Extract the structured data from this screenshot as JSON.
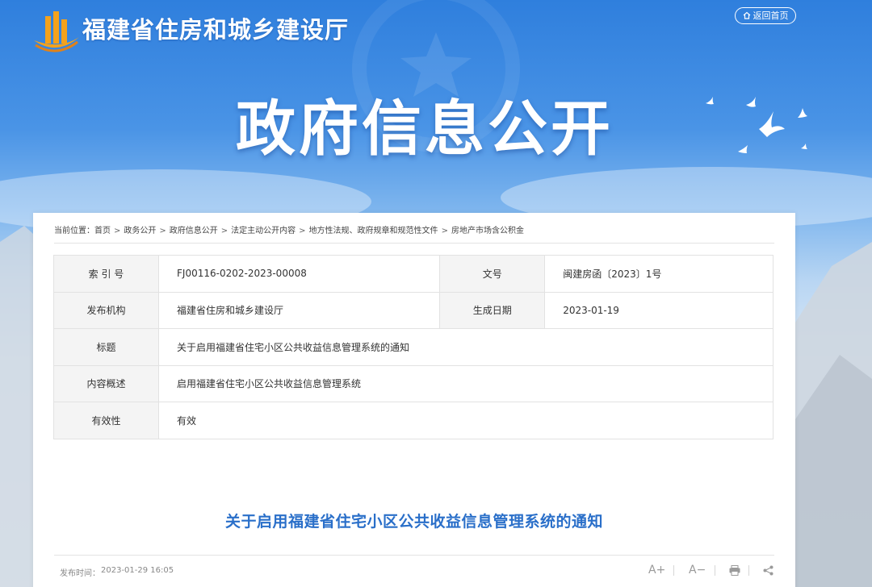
{
  "header": {
    "site_title": "福建省住房和城乡建设厅",
    "home_label": "返回首页",
    "banner_title": "政府信息公开"
  },
  "breadcrumb": {
    "prefix": "当前位置：",
    "items": [
      "首页",
      "政务公开",
      "政府信息公开",
      "法定主动公开内容",
      "地方性法规、政府规章和规范性文件",
      "房地产市场含公积金"
    ],
    "separator": ">"
  },
  "meta_table": {
    "index_label": "索 引 号",
    "index_value": "FJ00116-0202-2023-00008",
    "docno_label": "文号",
    "docno_value": "闽建房函〔2023〕1号",
    "issuer_label": "发布机构",
    "issuer_value": "福建省住房和城乡建设厅",
    "date_label": "生成日期",
    "date_value": "2023-01-19",
    "title_label": "标题",
    "title_value": "关于启用福建省住宅小区公共收益信息管理系统的通知",
    "summary_label": "内容概述",
    "summary_value": "启用福建省住宅小区公共收益信息管理系统",
    "validity_label": "有效性",
    "validity_value": "有效"
  },
  "article": {
    "title": "关于启用福建省住宅小区公共收益信息管理系统的通知",
    "publish_label": "发布时间：",
    "publish_time": "2023-01-29 16:05",
    "font_increase": "A+",
    "font_decrease": "A−"
  },
  "colors": {
    "accent_blue": "#2a6fc9",
    "banner_blue": "#2f7fdd"
  },
  "icons": [
    "home-icon",
    "logo-icon",
    "doves-icon",
    "print-icon",
    "share-icon"
  ]
}
